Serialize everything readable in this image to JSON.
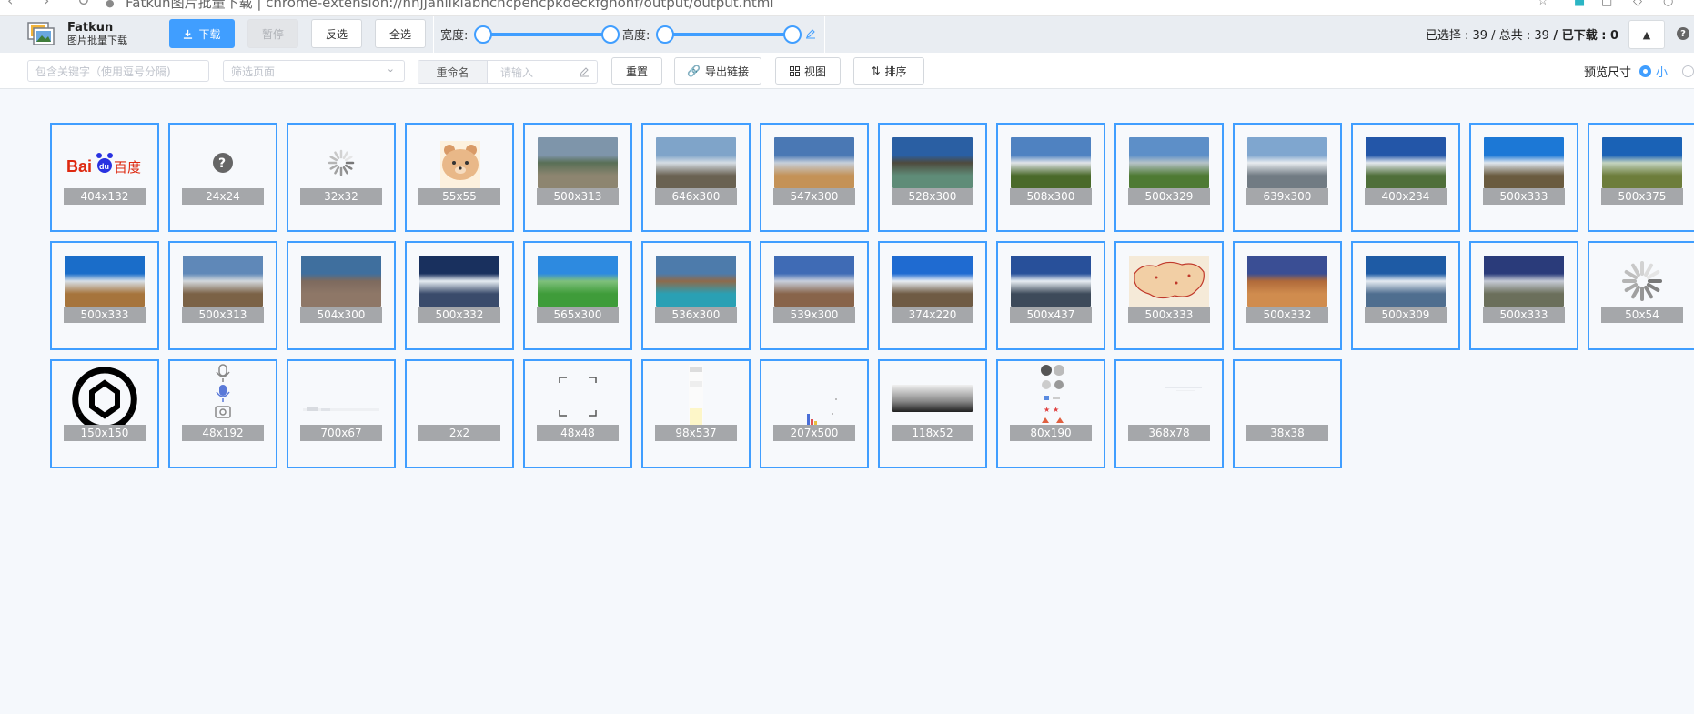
{
  "browser": {
    "url": "Fatkun图片批量下载 | chrome-extension://nnjjahlikiabnchcpehcpkdeckfgnohf/output/output.html"
  },
  "app": {
    "name": "Fatkun",
    "subtitle": "图片批量下载"
  },
  "toolbar": {
    "download": "下载",
    "pause": "暂停",
    "invert": "反选",
    "select_all": "全选",
    "width_label": "宽度:",
    "height_label": "高度:",
    "stats": {
      "selected_label": "已选择 : ",
      "selected": "39",
      "total_label": " / 总共 : ",
      "total": "39",
      "downloaded_label": " / 已下载 : ",
      "downloaded": "0"
    }
  },
  "filters": {
    "keyword_placeholder": "包含关键字（使用逗号分隔)",
    "page_placeholder": "筛选页面",
    "rename_label": "重命名",
    "rename_placeholder": "请输入",
    "reset": "重置",
    "export": "导出链接",
    "view": "视图",
    "sort": "排序",
    "preview_label": "预览尺寸",
    "preview_small": "小"
  },
  "images": [
    {
      "size": "404x132",
      "kind": "baidu"
    },
    {
      "size": "24x24",
      "kind": "question"
    },
    {
      "size": "32x32",
      "kind": "spinner"
    },
    {
      "size": "55x55",
      "kind": "bear"
    },
    {
      "size": "500x313",
      "kind": "photo",
      "top": "#7e95aa",
      "mid": "#596f56",
      "bot": "#8d8570"
    },
    {
      "size": "646x300",
      "kind": "photo",
      "top": "#7fa4c9",
      "mid": "#d5dde4",
      "bot": "#6a6252"
    },
    {
      "size": "547x300",
      "kind": "photo",
      "top": "#4a78b4",
      "mid": "#c6cfda",
      "bot": "#c49257"
    },
    {
      "size": "528x300",
      "kind": "photo",
      "top": "#2a5fa3",
      "mid": "#4e4a3d",
      "bot": "#5f8c78"
    },
    {
      "size": "508x300",
      "kind": "photo",
      "top": "#4f82c1",
      "mid": "#e0e4e8",
      "bot": "#4a6a2a"
    },
    {
      "size": "500x329",
      "kind": "photo",
      "top": "#5d8fc8",
      "mid": "#b6c3c8",
      "bot": "#4e7a33"
    },
    {
      "size": "639x300",
      "kind": "photo",
      "top": "#7fa6cf",
      "mid": "#e8ecf0",
      "bot": "#717b83"
    },
    {
      "size": "400x234",
      "kind": "photo",
      "top": "#2356a8",
      "mid": "#e3e8ee",
      "bot": "#4f6f3a"
    },
    {
      "size": "500x333",
      "kind": "photo",
      "top": "#1c78d6",
      "mid": "#dfe6ee",
      "bot": "#6a5b3f"
    },
    {
      "size": "500x375",
      "kind": "photo",
      "top": "#1a62b6",
      "mid": "#c4d4c0",
      "bot": "#6d7d3b"
    },
    {
      "size": "500x333",
      "kind": "photo",
      "top": "#1a6dc9",
      "mid": "#d7dfe7",
      "bot": "#a6743c"
    },
    {
      "size": "500x313",
      "kind": "photo",
      "top": "#5f88b8",
      "mid": "#d3d8dc",
      "bot": "#7b6246"
    },
    {
      "size": "504x300",
      "kind": "photo",
      "top": "#3f6f9e",
      "mid": "#7d6a5e",
      "bot": "#8e7767"
    },
    {
      "size": "500x332",
      "kind": "photo",
      "top": "#19305e",
      "mid": "#e6edf3",
      "bot": "#3a4b6b"
    },
    {
      "size": "565x300",
      "kind": "photo",
      "top": "#2d8ae0",
      "mid": "#7fc07c",
      "bot": "#3f9c3a"
    },
    {
      "size": "536x300",
      "kind": "photo",
      "top": "#4d7bab",
      "mid": "#8e6a4b",
      "bot": "#2aa0b4"
    },
    {
      "size": "539x300",
      "kind": "photo",
      "top": "#3f6bb5",
      "mid": "#c8cfdc",
      "bot": "#88644a"
    },
    {
      "size": "374x220",
      "kind": "photo",
      "top": "#1f6bd1",
      "mid": "#e9eef4",
      "bot": "#6f5b44"
    },
    {
      "size": "500x437",
      "kind": "photo",
      "top": "#28509a",
      "mid": "#e8eef3",
      "bot": "#3d4a5a"
    },
    {
      "size": "500x333",
      "kind": "map"
    },
    {
      "size": "500x332",
      "kind": "photo",
      "top": "#3a4e94",
      "mid": "#b06a3a",
      "bot": "#d08c4e"
    },
    {
      "size": "500x309",
      "kind": "photo",
      "top": "#1e5ba5",
      "mid": "#e5ebf1",
      "bot": "#4f6e8f"
    },
    {
      "size": "500x333",
      "kind": "photo",
      "top": "#2a3b7a",
      "mid": "#c6cbd6",
      "bot": "#6b6f5b"
    },
    {
      "size": "50x54",
      "kind": "spinner-big"
    },
    {
      "size": "150x150",
      "kind": "openai"
    },
    {
      "size": "48x192",
      "kind": "mics"
    },
    {
      "size": "700x67",
      "kind": "faint-strip"
    },
    {
      "size": "2x2",
      "kind": "blank"
    },
    {
      "size": "48x48",
      "kind": "corners"
    },
    {
      "size": "98x537",
      "kind": "tall-ui"
    },
    {
      "size": "207x500",
      "kind": "chart-ui"
    },
    {
      "size": "118x52",
      "kind": "gradient"
    },
    {
      "size": "80x190",
      "kind": "sprite"
    },
    {
      "size": "368x78",
      "kind": "faint"
    },
    {
      "size": "38x38",
      "kind": "blank"
    }
  ]
}
